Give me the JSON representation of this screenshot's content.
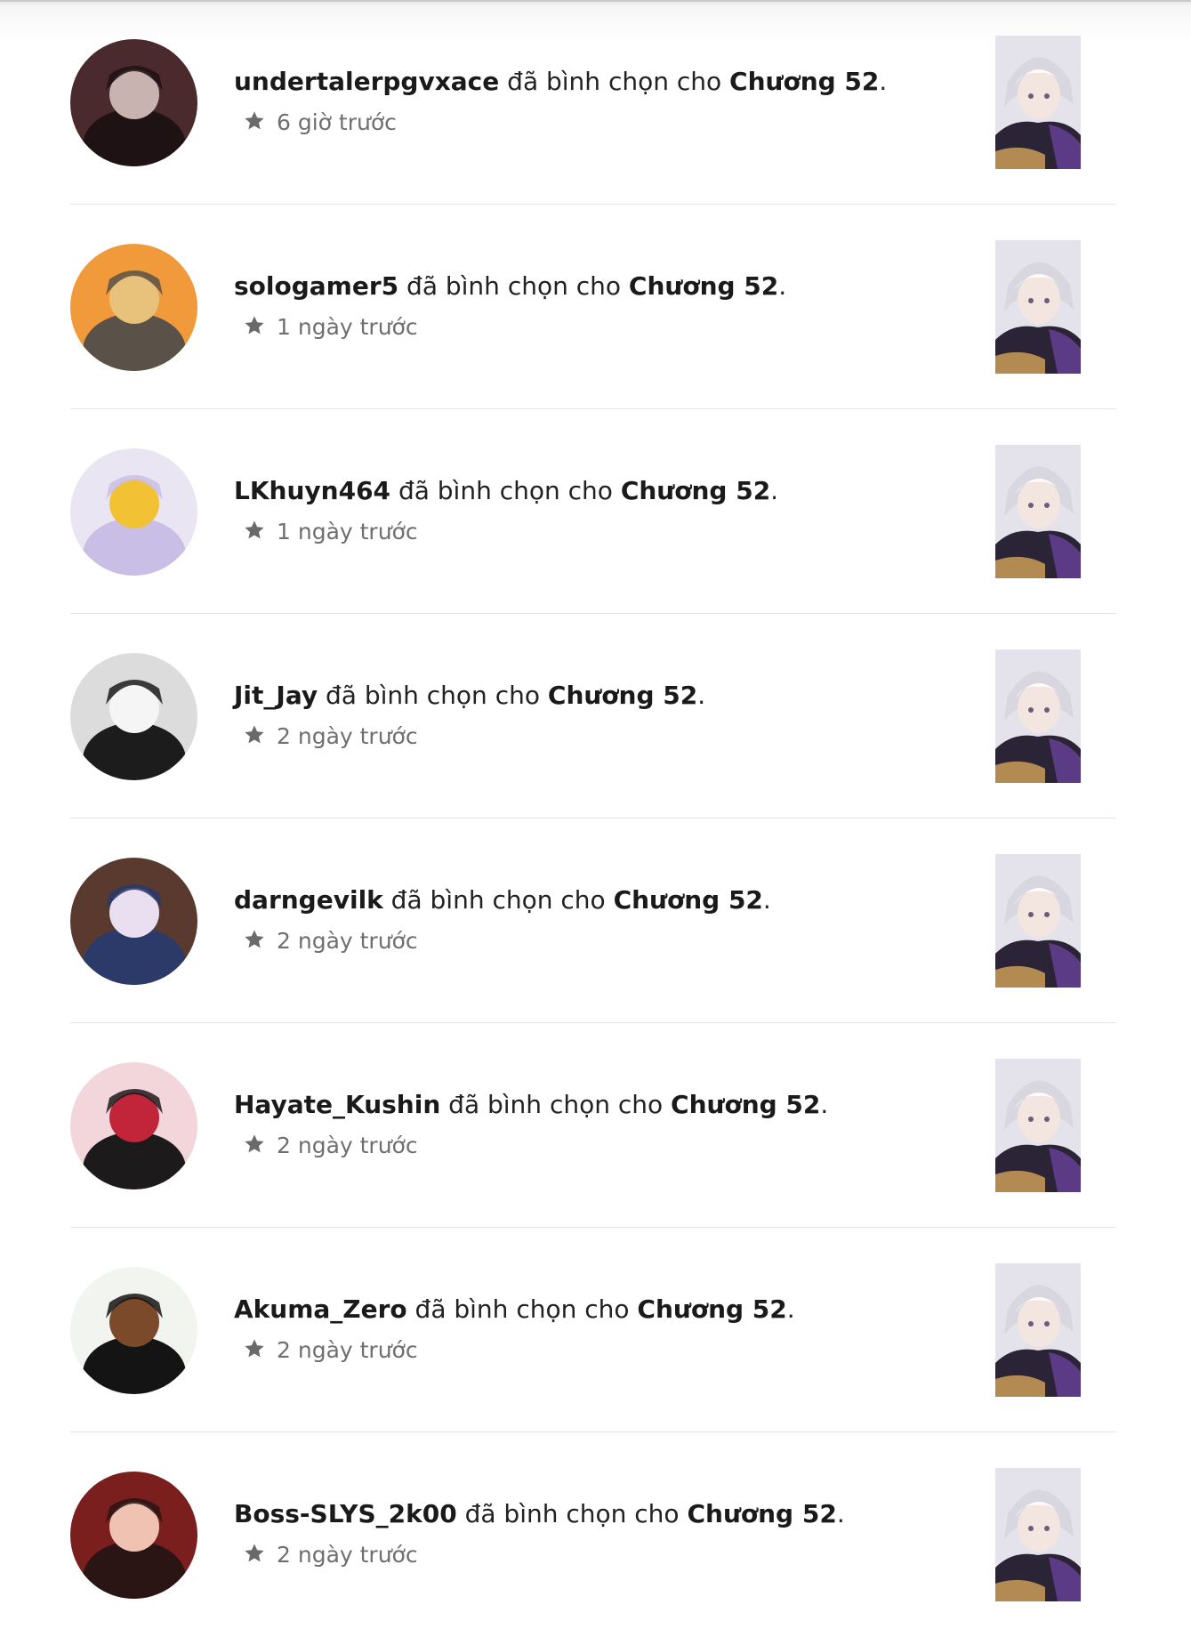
{
  "feed": {
    "items": [
      {
        "username": "undertalerpgvxace",
        "action": " đã bình chọn cho ",
        "chapter": "Chương 52",
        "period": ".",
        "time": "6 giờ trước",
        "avatar_bg": "#4a2a2c",
        "avatar_fg": "#1e1214",
        "avatar_accent": "#c9b3b0"
      },
      {
        "username": "sologamer5",
        "action": " đã bình chọn cho ",
        "chapter": "Chương 52",
        "period": ".",
        "time": "1 ngày trước",
        "avatar_bg": "#f09a3c",
        "avatar_fg": "#5a5148",
        "avatar_accent": "#e8c27a"
      },
      {
        "username": "LKhuyn464",
        "action": " đã bình chọn cho ",
        "chapter": "Chương 52",
        "period": ".",
        "time": "1 ngày trước",
        "avatar_bg": "#e9e5f2",
        "avatar_fg": "#c9bfe6",
        "avatar_accent": "#f2c234"
      },
      {
        "username": "Jit_Jay",
        "action": " đã bình chọn cho ",
        "chapter": "Chương 52",
        "period": ".",
        "time": "2 ngày trước",
        "avatar_bg": "#dcdcdc",
        "avatar_fg": "#1c1c1c",
        "avatar_accent": "#f5f5f5"
      },
      {
        "username": "darngevilk",
        "action": " đã bình chọn cho ",
        "chapter": "Chương 52",
        "period": ".",
        "time": "2 ngày trước",
        "avatar_bg": "#5a3a2e",
        "avatar_fg": "#2c3a6a",
        "avatar_accent": "#eadff0"
      },
      {
        "username": "Hayate_Kushin",
        "action": " đã bình chọn cho ",
        "chapter": "Chương 52",
        "period": ".",
        "time": "2 ngày trước",
        "avatar_bg": "#f3d6dc",
        "avatar_fg": "#1d1a1c",
        "avatar_accent": "#c2243a"
      },
      {
        "username": "Akuma_Zero",
        "action": " đã bình chọn cho ",
        "chapter": "Chương 52",
        "period": ".",
        "time": "2 ngày trước",
        "avatar_bg": "#f2f5ef",
        "avatar_fg": "#141414",
        "avatar_accent": "#7a4a2a"
      },
      {
        "username": "Boss-SLYS_2k00",
        "action": " đã bình chọn cho ",
        "chapter": "Chương 52",
        "period": ".",
        "time": "2 ngày trước",
        "avatar_bg": "#7a1e1e",
        "avatar_fg": "#2a1414",
        "avatar_accent": "#f0c2b2"
      }
    ]
  },
  "colors": {
    "text": "#222222",
    "muted": "#6f6f6f",
    "divider": "#e4e4e4",
    "star": "#6a6a6a"
  },
  "icons": {
    "star": "star-icon"
  }
}
